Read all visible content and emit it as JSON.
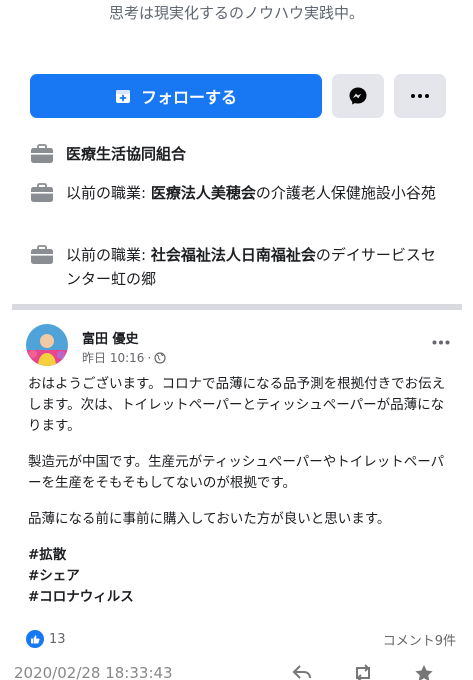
{
  "profile": {
    "bio_line": "思考は現実化するのノウハウ実践中。",
    "follow_label": "フォローする"
  },
  "work": [
    {
      "prefix": "",
      "org": "医療生活協同組合",
      "suffix": ""
    },
    {
      "prefix": "以前の職業: ",
      "org": "医療法人美穂会",
      "suffix": "の介護老人保健施設小谷苑"
    },
    {
      "prefix": "以前の職業: ",
      "org": "社会福祉法人日南福祉会",
      "suffix": "のデイサービスセンター虹の郷"
    }
  ],
  "post": {
    "author": "富田 優史",
    "time": "昨日 10:16",
    "separator": "·",
    "paragraphs": [
      "おはようございます。コロナで品薄になる品予測を根拠付きでお伝えします。次は、トイレットペーパーとティッシュぺーパーが品薄になります。",
      "製造元が中国です。生産元がティッシュぺーパーやトイレットペーパーを生産をそもそもしてないのが根拠です。",
      "品薄になる前に事前に購入しておいた方が良いと思います。"
    ],
    "hashtags": [
      "#拡散",
      "#シェア",
      "#コロナウィルス"
    ],
    "like_count": "13",
    "comment_count": "コメント9件"
  },
  "footer": {
    "timestamp": "2020/02/28 18:33:43"
  },
  "colors": {
    "accent": "#1877f2",
    "secondary_button": "#e4e6eb"
  },
  "icons": [
    "follow-plus-icon",
    "messenger-icon",
    "more-icon",
    "briefcase-icon",
    "globe-icon",
    "like-icon",
    "reply-icon",
    "retweet-icon",
    "star-icon"
  ]
}
